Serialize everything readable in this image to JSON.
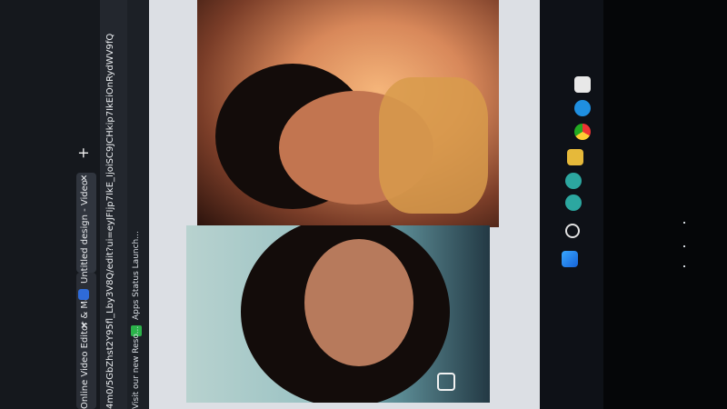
{
  "browser": {
    "tabs": [
      {
        "label": "Online Video Editor & Ma",
        "close": "✕"
      },
      {
        "label": "Untitled design - Video",
        "close": "✕"
      }
    ],
    "new_tab": "+",
    "url": "4m0/5GbZhst2Y95fl_Lby3V8Q/edit?ui=eyJFIjp7IkE_IjoiSC9JCHkip7IkEiOnRydWV9fQ",
    "bookmarks": [
      {
        "label": "Visit our new Reso..."
      },
      {
        "label": "Apps Status Launch..."
      }
    ]
  },
  "taskbar": {
    "icons": [
      "recycle-bin-icon",
      "edge-icon",
      "chrome-icon",
      "file-explorer-icon",
      "chat-icon",
      "chat-icon-2",
      "search-icon",
      "windows-start-icon"
    ]
  }
}
